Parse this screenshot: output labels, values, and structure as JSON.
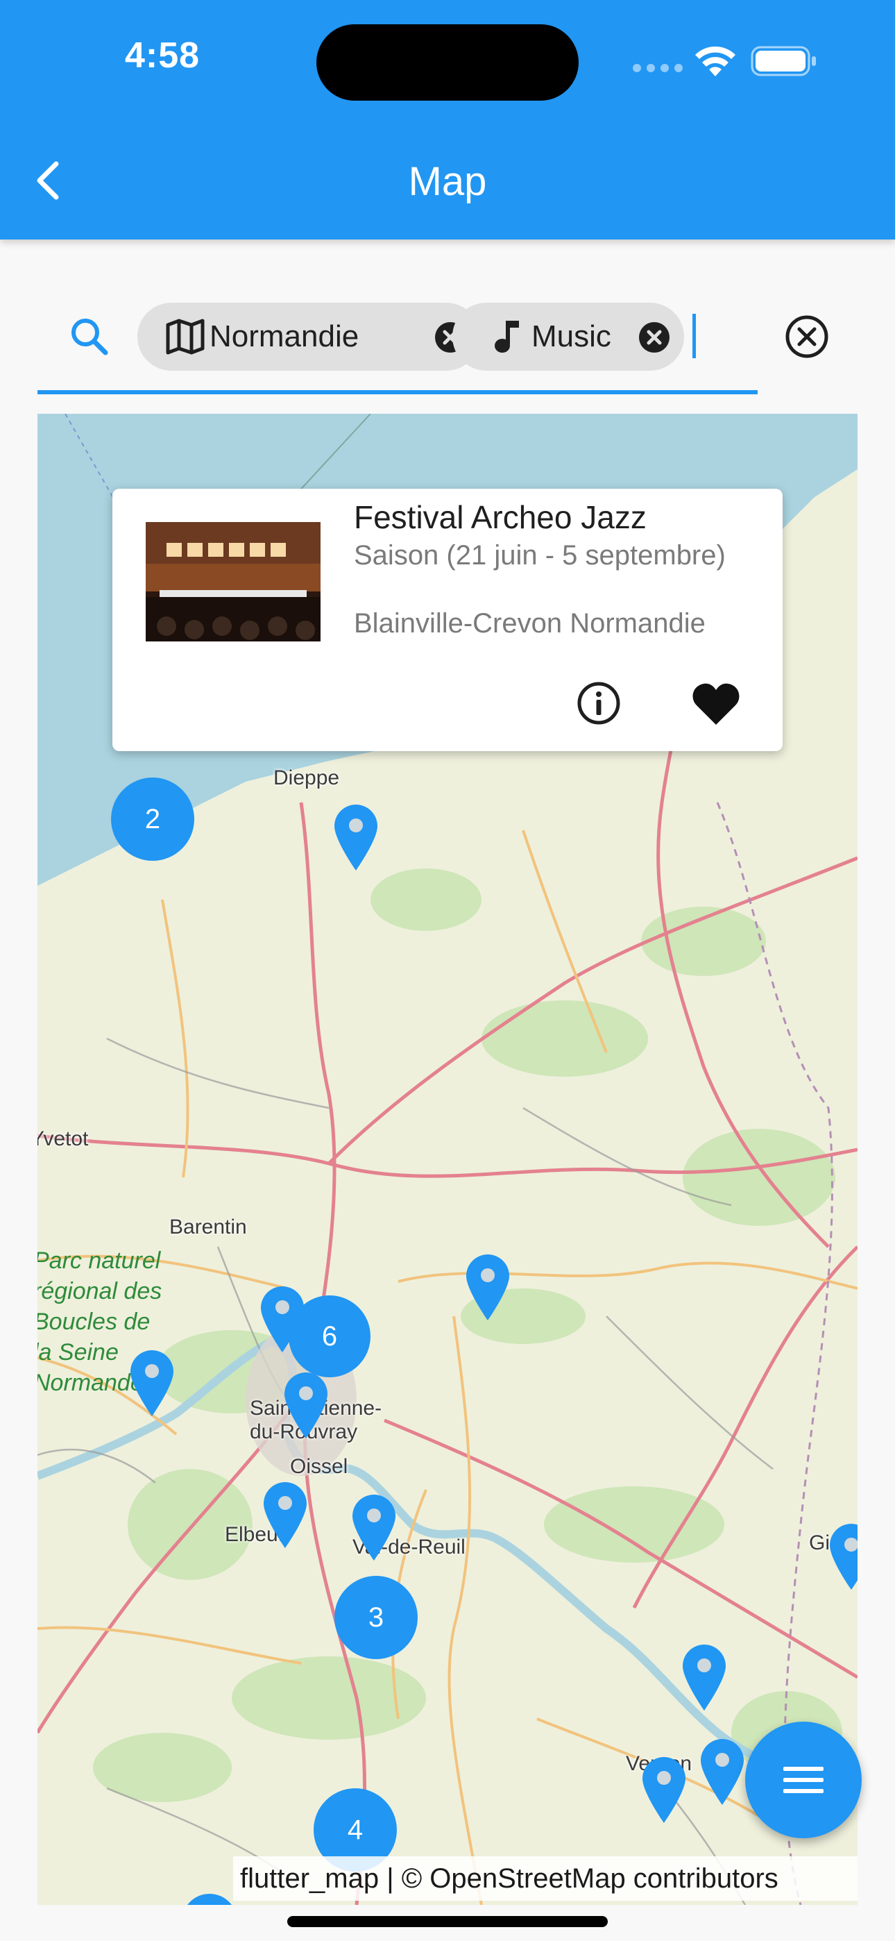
{
  "status_bar": {
    "time": "4:58"
  },
  "app_bar": {
    "title": "Map"
  },
  "search": {
    "chips": [
      {
        "label": "Normandie",
        "icon": "map-icon"
      },
      {
        "label": "Music",
        "icon": "music-note-icon"
      }
    ]
  },
  "popup": {
    "title": "Festival Archeo Jazz",
    "subtitle": "Saison (21 juin - 5 septembre)",
    "location": "Blainville-Crevon Normandie"
  },
  "map": {
    "places": [
      "Dieppe",
      "Yvetot",
      "Barentin",
      "Saint-Étienne-du-Rouvray",
      "Oissel",
      "Elbeuf",
      "Val-de-Reuil",
      "Vernon",
      "Gisors"
    ],
    "park_label": "Parc naturel régional des Boucles de la Seine Normande",
    "clusters": [
      {
        "count": "2"
      },
      {
        "count": "6"
      },
      {
        "count": "3"
      },
      {
        "count": "4"
      }
    ],
    "attribution": "flutter_map | © OpenStreetMap contributors"
  },
  "colors": {
    "primary": "#2196f3",
    "chip_bg": "#e0e0e0",
    "map_sea": "#aad3df"
  }
}
